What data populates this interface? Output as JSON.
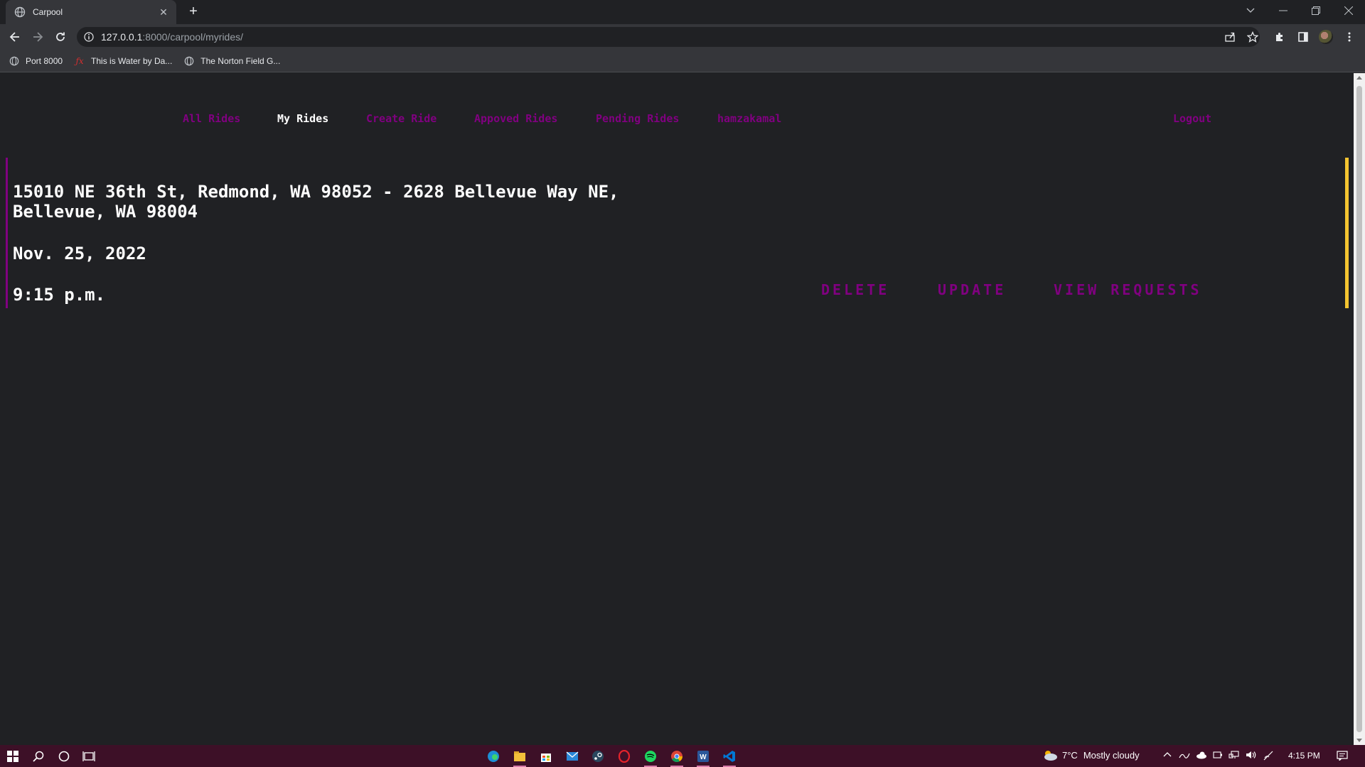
{
  "browser": {
    "tab_title": "Carpool",
    "url_host": "127.0.0.1",
    "url_path": ":8000/carpool/myrides/",
    "bookmarks": [
      {
        "label": "Port 8000",
        "icon": "globe-icon"
      },
      {
        "label": "This is Water by Da...",
        "icon": "script-icon"
      },
      {
        "label": "The Norton Field G...",
        "icon": "globe-icon"
      }
    ]
  },
  "nav": {
    "all_rides": "All Rides",
    "my_rides": "My Rides",
    "create_ride": "Create Ride",
    "approved_rides": "Appoved Rides",
    "pending_rides": "Pending Rides",
    "username": "hamzakamal",
    "logout": "Logout"
  },
  "ride": {
    "route": "15010 NE 36th St, Redmond, WA 98052 - 2628 Bellevue Way NE, Bellevue, WA 98004",
    "date": "Nov. 25, 2022",
    "time": "9:15 p.m.",
    "delete_label": "DELETE",
    "update_label": "UPDATE",
    "view_requests_label": "VIEW REQUESTS"
  },
  "taskbar": {
    "weather_temp": "7°C",
    "weather_text": "Mostly cloudy",
    "clock": "4:15 PM"
  },
  "colors": {
    "accent_purple": "#800080",
    "card_right_border": "#f4c430",
    "page_bg": "#202124",
    "taskbar_bg": "#3d1027"
  }
}
